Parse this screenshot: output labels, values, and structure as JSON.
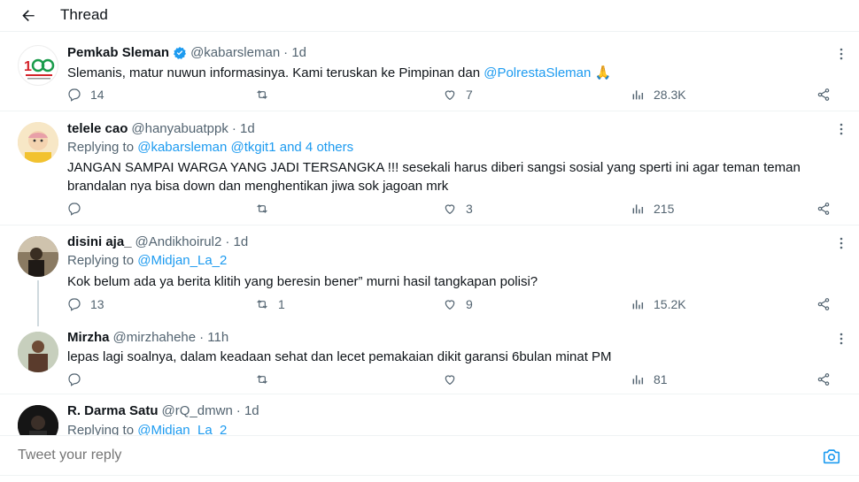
{
  "header": {
    "title": "Thread"
  },
  "tweets": [
    {
      "display_name": "Pemkab Sleman",
      "handle": "@kabarsleman",
      "time": "· 1d",
      "verified": true,
      "text": "Slemanis, matur nuwun informasinya. Kami teruskan ke Pimpinan dan ",
      "text_mention": "@PolrestaSleman",
      "text_emoji": " 🙏",
      "stats": {
        "replies": "14",
        "retweets": "",
        "likes": "7",
        "views": "28.3K"
      }
    },
    {
      "display_name": "telele cao",
      "handle": "@hanyabuatppk",
      "time": "· 1d",
      "replying_to_label": "Replying to ",
      "replying_to": "@kabarsleman @tkgit1 and 4 others",
      "text": "JANGAN SAMPAI WARGA YANG JADI TERSANGKA !!! sesekali harus diberi sangsi sosial yang sperti ini agar teman teman brandalan nya bisa down dan menghentikan jiwa sok jagoan mrk",
      "stats": {
        "replies": "",
        "retweets": "",
        "likes": "3",
        "views": "215"
      }
    },
    {
      "display_name": "disini aja_",
      "handle": "@Andikhoirul2",
      "time": "· 1d",
      "replying_to_label": "Replying to ",
      "replying_to": "@Midjan_La_2",
      "text": "Kok belum ada ya berita klitih yang beresin bener” murni hasil tangkapan polisi?",
      "stats": {
        "replies": "13",
        "retweets": "1",
        "likes": "9",
        "views": "15.2K"
      }
    },
    {
      "display_name": "Mirzha",
      "handle": "@mirzhahehe",
      "time": "· 11h",
      "text": "lepas lagi soalnya, dalam keadaan sehat dan lecet pemakaian dikit garansi 6bulan minat PM",
      "stats": {
        "replies": "",
        "retweets": "",
        "likes": "",
        "views": "81"
      }
    },
    {
      "display_name": "R. Darma Satu",
      "handle": "@rQ_dmwn",
      "time": "· 1d",
      "replying_to_label": "Replying to ",
      "replying_to": "@Midjan_La_2"
    }
  ],
  "reply_box": {
    "placeholder": "Tweet your reply"
  },
  "colors": {
    "accent": "#1d9bf0",
    "muted": "#536471",
    "text": "#0f1419",
    "border": "#eff3f4"
  },
  "icons": [
    "back-arrow-icon",
    "verified-badge-icon",
    "more-icon",
    "reply-icon",
    "retweet-icon",
    "like-icon",
    "views-icon",
    "share-icon",
    "camera-icon"
  ]
}
